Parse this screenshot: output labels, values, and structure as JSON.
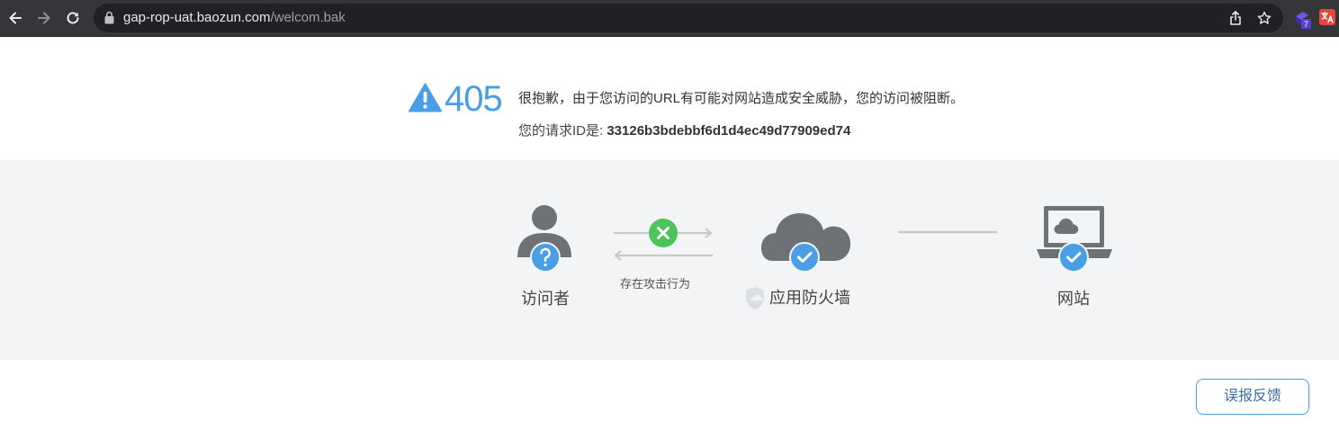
{
  "browser": {
    "url_host": "gap-rop-uat.baozun.com",
    "url_path": "/welcom.bak",
    "extension_badge": "7",
    "extension_badge_color": "#5b3fd4",
    "translate_ext_color": "#e8453c"
  },
  "error": {
    "code": "405",
    "message": "很抱歉，由于您访问的URL有可能对网站造成安全威胁，您的访问被阻断。",
    "request_id_label": "您的请求ID是: ",
    "request_id": "33126b3bdebbf6d1d4ec49d77909ed74",
    "accent_color": "#4a9ee6"
  },
  "diagram": {
    "visitor_label": "访问者",
    "attack_label": "存在攻击行为",
    "waf_label": "应用防火墙",
    "site_label": "网站",
    "visitor_status_icon": "question-icon",
    "waf_status_icon": "check-icon",
    "site_status_icon": "check-icon",
    "attack_status_icon": "x-icon",
    "ok_color": "#4a9ee6",
    "blocked_color": "#4cc45a"
  },
  "actions": {
    "report_label": "误报反馈"
  }
}
